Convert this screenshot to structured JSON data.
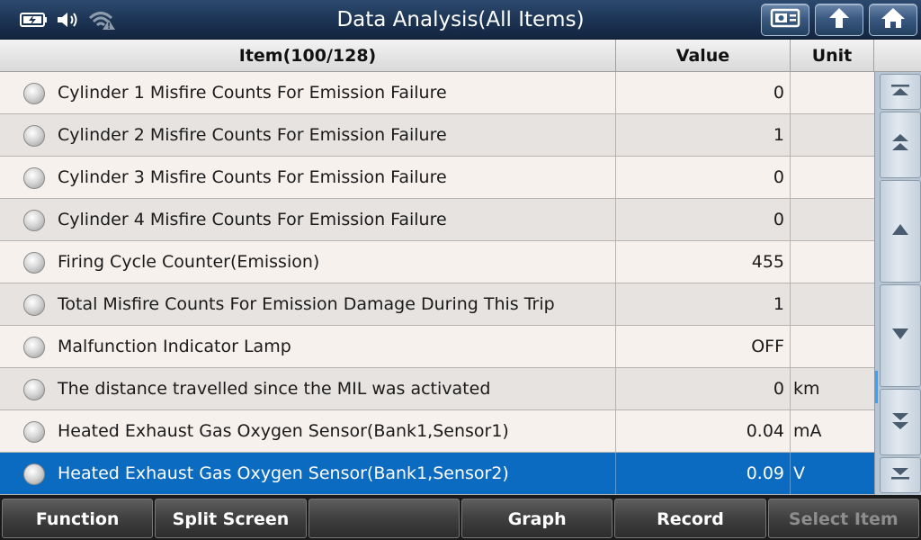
{
  "titlebar": {
    "title": "Data Analysis(All Items)",
    "status_icons": [
      "battery-charging-icon",
      "speaker-icon",
      "wifi-warning-icon"
    ],
    "buttons": [
      "screenshot-icon",
      "back-arrow-icon",
      "home-icon"
    ]
  },
  "table": {
    "headers": {
      "item": "Item(100/128)",
      "value": "Value",
      "unit": "Unit"
    },
    "rows": [
      {
        "name": "Cylinder 1 Misfire Counts For Emission Failure",
        "value": "0",
        "unit": ""
      },
      {
        "name": "Cylinder 2 Misfire Counts For Emission Failure",
        "value": "1",
        "unit": ""
      },
      {
        "name": "Cylinder 3 Misfire Counts For Emission Failure",
        "value": "0",
        "unit": ""
      },
      {
        "name": "Cylinder 4 Misfire Counts For Emission Failure",
        "value": "0",
        "unit": ""
      },
      {
        "name": "Firing Cycle Counter(Emission)",
        "value": "455",
        "unit": ""
      },
      {
        "name": "Total Misfire Counts For Emission Damage During This Trip",
        "value": "1",
        "unit": ""
      },
      {
        "name": "Malfunction Indicator Lamp",
        "value": "OFF",
        "unit": ""
      },
      {
        "name": "The distance travelled since the MIL was activated",
        "value": "0",
        "unit": "km"
      },
      {
        "name": "Heated Exhaust Gas Oxygen Sensor(Bank1,Sensor1)",
        "value": "0.04",
        "unit": "mA"
      },
      {
        "name": "Heated Exhaust Gas Oxygen Sensor(Bank1,Sensor2)",
        "value": "0.09",
        "unit": "V"
      }
    ],
    "selected_index": 9
  },
  "scroll": {
    "buttons": [
      "scroll-top-icon",
      "page-up-icon",
      "scroll-up-icon",
      "scroll-down-icon",
      "page-down-icon",
      "scroll-bottom-icon"
    ]
  },
  "bottombar": {
    "function": "Function",
    "split_screen": "Split Screen",
    "blank": "",
    "graph": "Graph",
    "record": "Record",
    "select_item": "Select Item"
  },
  "colors": {
    "selected_row": "#0a6bc0",
    "titlebar": "#1c3353",
    "scroll_indicator": "#3aa0ff"
  }
}
